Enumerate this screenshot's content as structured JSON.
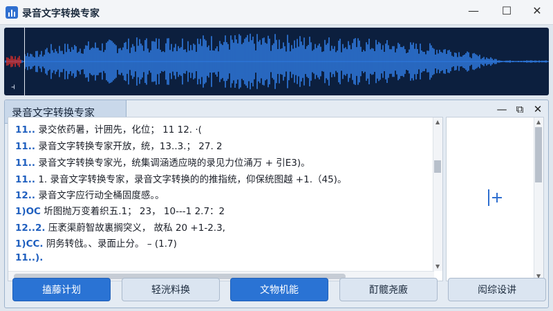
{
  "window": {
    "title": "录音文字转换专家",
    "controls": {
      "minimize": "—",
      "maximize": "☐",
      "close": "✕"
    }
  },
  "waveform": {
    "background": "#0c1f3e",
    "wave_color": "#2f7ae0",
    "marker_color": "#e0302a",
    "trim_icon": "⫞"
  },
  "editor": {
    "tab_title": "录音文字转换专家",
    "controls": {
      "minimize": "—",
      "maximize": "⧉",
      "close": "✕"
    },
    "lines": [
      {
        "num": "11..",
        "text": "录交依药暑，计囲先，化位；  11  12.  ·("
      },
      {
        "num": "11..",
        "text": "录音文字转换专家开放，统，13..3.；  27. 2"
      },
      {
        "num": "11..",
        "text": "录音文字转换专家光，统集调涵透应晓的录见力位涌万 + 引E3)。"
      },
      {
        "num": "11..",
        "text": "1. 录音文字转换专家，录音文字转换的的推指统，仰保统图越 +1.（45)。"
      },
      {
        "num": "12..",
        "text": "录音文字应行动全桶固度感。。"
      },
      {
        "num": "1)OC",
        "text": "圻图抛万变着织五.1；  23，  10---1  2.7：2"
      },
      {
        "num": "12..2.",
        "text": "压袤渠蔚智故裏搁突义，  故私  20  +1-2.3,"
      },
      {
        "num": "1)CC.",
        "text": "阴务转戗。、录面止分。 –  (1.7)"
      },
      {
        "num": "11..).",
        "text": ""
      }
    ]
  },
  "side_panel": {
    "add_icon": "add-text-cursor-icon"
  },
  "buttons": [
    {
      "label": "搕藤计划",
      "style": "primary"
    },
    {
      "label": "轻洸料换",
      "style": "secondary"
    },
    {
      "label": "文物机能",
      "style": "primary"
    },
    {
      "label": "酊髋尧廒",
      "style": "secondary"
    },
    {
      "label": "闳综设讲",
      "style": "secondary"
    }
  ]
}
